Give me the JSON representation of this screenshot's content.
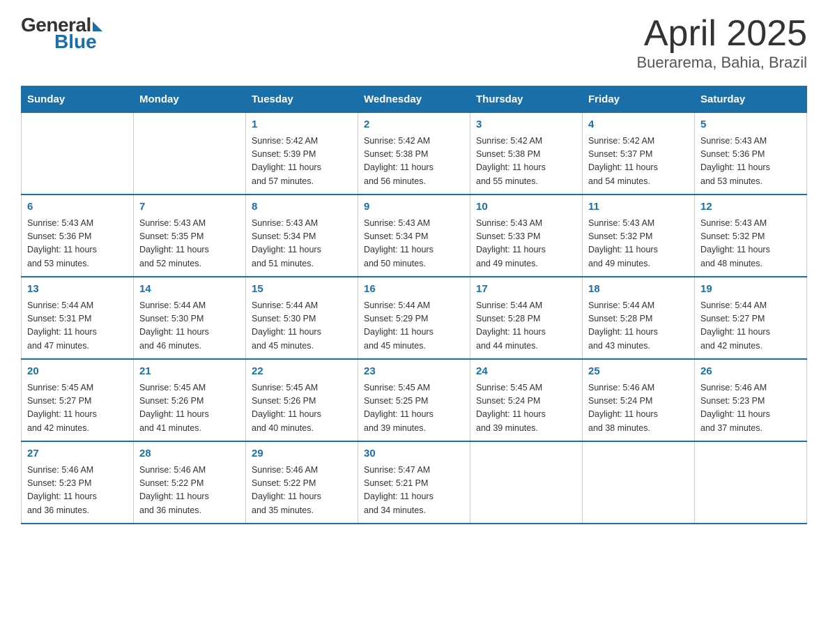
{
  "header": {
    "logo_general": "General",
    "logo_blue": "Blue",
    "month_title": "April 2025",
    "location": "Buerarema, Bahia, Brazil"
  },
  "calendar": {
    "headers": [
      "Sunday",
      "Monday",
      "Tuesday",
      "Wednesday",
      "Thursday",
      "Friday",
      "Saturday"
    ],
    "weeks": [
      [
        {
          "day": "",
          "info": ""
        },
        {
          "day": "",
          "info": ""
        },
        {
          "day": "1",
          "info": "Sunrise: 5:42 AM\nSunset: 5:39 PM\nDaylight: 11 hours\nand 57 minutes."
        },
        {
          "day": "2",
          "info": "Sunrise: 5:42 AM\nSunset: 5:38 PM\nDaylight: 11 hours\nand 56 minutes."
        },
        {
          "day": "3",
          "info": "Sunrise: 5:42 AM\nSunset: 5:38 PM\nDaylight: 11 hours\nand 55 minutes."
        },
        {
          "day": "4",
          "info": "Sunrise: 5:42 AM\nSunset: 5:37 PM\nDaylight: 11 hours\nand 54 minutes."
        },
        {
          "day": "5",
          "info": "Sunrise: 5:43 AM\nSunset: 5:36 PM\nDaylight: 11 hours\nand 53 minutes."
        }
      ],
      [
        {
          "day": "6",
          "info": "Sunrise: 5:43 AM\nSunset: 5:36 PM\nDaylight: 11 hours\nand 53 minutes."
        },
        {
          "day": "7",
          "info": "Sunrise: 5:43 AM\nSunset: 5:35 PM\nDaylight: 11 hours\nand 52 minutes."
        },
        {
          "day": "8",
          "info": "Sunrise: 5:43 AM\nSunset: 5:34 PM\nDaylight: 11 hours\nand 51 minutes."
        },
        {
          "day": "9",
          "info": "Sunrise: 5:43 AM\nSunset: 5:34 PM\nDaylight: 11 hours\nand 50 minutes."
        },
        {
          "day": "10",
          "info": "Sunrise: 5:43 AM\nSunset: 5:33 PM\nDaylight: 11 hours\nand 49 minutes."
        },
        {
          "day": "11",
          "info": "Sunrise: 5:43 AM\nSunset: 5:32 PM\nDaylight: 11 hours\nand 49 minutes."
        },
        {
          "day": "12",
          "info": "Sunrise: 5:43 AM\nSunset: 5:32 PM\nDaylight: 11 hours\nand 48 minutes."
        }
      ],
      [
        {
          "day": "13",
          "info": "Sunrise: 5:44 AM\nSunset: 5:31 PM\nDaylight: 11 hours\nand 47 minutes."
        },
        {
          "day": "14",
          "info": "Sunrise: 5:44 AM\nSunset: 5:30 PM\nDaylight: 11 hours\nand 46 minutes."
        },
        {
          "day": "15",
          "info": "Sunrise: 5:44 AM\nSunset: 5:30 PM\nDaylight: 11 hours\nand 45 minutes."
        },
        {
          "day": "16",
          "info": "Sunrise: 5:44 AM\nSunset: 5:29 PM\nDaylight: 11 hours\nand 45 minutes."
        },
        {
          "day": "17",
          "info": "Sunrise: 5:44 AM\nSunset: 5:28 PM\nDaylight: 11 hours\nand 44 minutes."
        },
        {
          "day": "18",
          "info": "Sunrise: 5:44 AM\nSunset: 5:28 PM\nDaylight: 11 hours\nand 43 minutes."
        },
        {
          "day": "19",
          "info": "Sunrise: 5:44 AM\nSunset: 5:27 PM\nDaylight: 11 hours\nand 42 minutes."
        }
      ],
      [
        {
          "day": "20",
          "info": "Sunrise: 5:45 AM\nSunset: 5:27 PM\nDaylight: 11 hours\nand 42 minutes."
        },
        {
          "day": "21",
          "info": "Sunrise: 5:45 AM\nSunset: 5:26 PM\nDaylight: 11 hours\nand 41 minutes."
        },
        {
          "day": "22",
          "info": "Sunrise: 5:45 AM\nSunset: 5:26 PM\nDaylight: 11 hours\nand 40 minutes."
        },
        {
          "day": "23",
          "info": "Sunrise: 5:45 AM\nSunset: 5:25 PM\nDaylight: 11 hours\nand 39 minutes."
        },
        {
          "day": "24",
          "info": "Sunrise: 5:45 AM\nSunset: 5:24 PM\nDaylight: 11 hours\nand 39 minutes."
        },
        {
          "day": "25",
          "info": "Sunrise: 5:46 AM\nSunset: 5:24 PM\nDaylight: 11 hours\nand 38 minutes."
        },
        {
          "day": "26",
          "info": "Sunrise: 5:46 AM\nSunset: 5:23 PM\nDaylight: 11 hours\nand 37 minutes."
        }
      ],
      [
        {
          "day": "27",
          "info": "Sunrise: 5:46 AM\nSunset: 5:23 PM\nDaylight: 11 hours\nand 36 minutes."
        },
        {
          "day": "28",
          "info": "Sunrise: 5:46 AM\nSunset: 5:22 PM\nDaylight: 11 hours\nand 36 minutes."
        },
        {
          "day": "29",
          "info": "Sunrise: 5:46 AM\nSunset: 5:22 PM\nDaylight: 11 hours\nand 35 minutes."
        },
        {
          "day": "30",
          "info": "Sunrise: 5:47 AM\nSunset: 5:21 PM\nDaylight: 11 hours\nand 34 minutes."
        },
        {
          "day": "",
          "info": ""
        },
        {
          "day": "",
          "info": ""
        },
        {
          "day": "",
          "info": ""
        }
      ]
    ]
  }
}
